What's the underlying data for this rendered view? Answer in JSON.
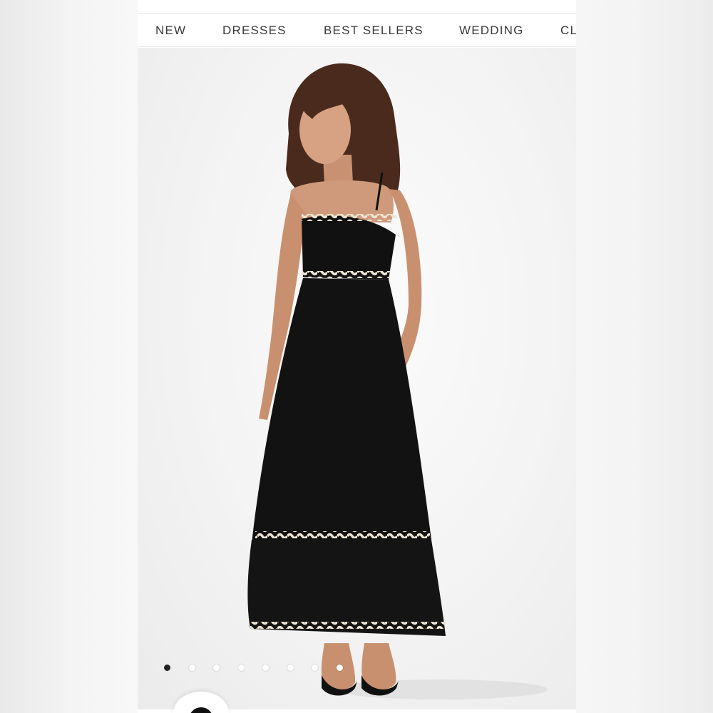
{
  "nav": {
    "items": [
      {
        "label": "NEW"
      },
      {
        "label": "DRESSES"
      },
      {
        "label": "BEST SELLERS"
      },
      {
        "label": "WEDDING"
      },
      {
        "label": "CL"
      }
    ]
  },
  "gallery": {
    "image_count": 8,
    "active_index": 0
  },
  "colors": {
    "dress": "#111111",
    "trim": "#ece3d2",
    "active_dot": "#222222",
    "inactive_dot": "#ffffff"
  },
  "icons": {
    "chat_button": "chat-bubble-icon"
  }
}
